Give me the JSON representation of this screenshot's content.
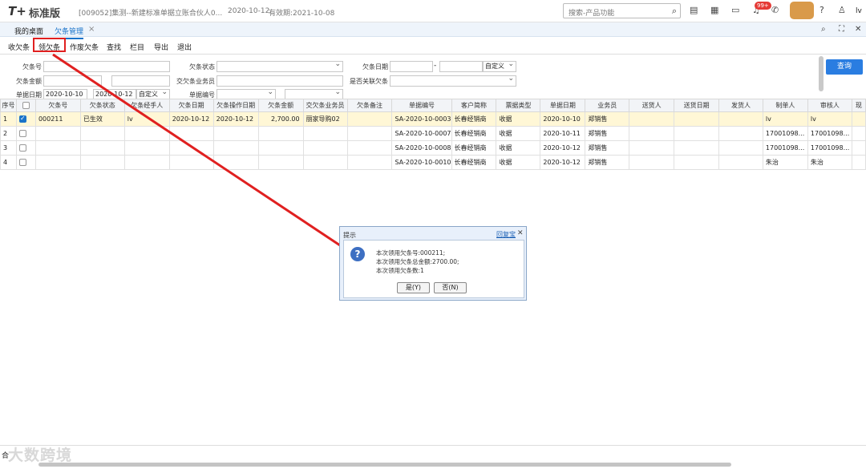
{
  "app": {
    "logo": "T+",
    "edition": "标准版",
    "company": "[009052]集测--新建标准单据立账合伙人0...",
    "date": "2020-10-12",
    "validity": "有效期:2021-10-08",
    "search_placeholder": "搜索-产品功能",
    "badge": "99+",
    "user": "lv"
  },
  "tabs": [
    {
      "label": "我的桌面"
    },
    {
      "label": "欠条管理"
    }
  ],
  "menu": [
    "收欠条",
    "领欠条",
    "作废欠条",
    "查找",
    "栏目",
    "导出",
    "退出"
  ],
  "filters": {
    "iou_no": "欠条号",
    "iou_status": "欠条状态",
    "iou_date": "欠条日期",
    "iou_amount": "欠条金额",
    "iou_agent": "交欠条业务员",
    "related": "是否关联欠条",
    "doc_date": "单据日期",
    "doc_date_from": "2020-10-10",
    "doc_date_to": "2020-10-12",
    "custom": "自定义",
    "doc_no": "单据编号",
    "query_button": "查询"
  },
  "table": {
    "columns": [
      "序号",
      "",
      "欠条号",
      "欠条状态",
      "欠条经手人",
      "欠条日期",
      "欠条操作日期",
      "欠条金额",
      "交欠条业务员",
      "欠条备注",
      "单据编号",
      "客户简称",
      "票据类型",
      "单据日期",
      "业务员",
      "送货人",
      "送货日期",
      "发货人",
      "制单人",
      "审核人",
      "现"
    ],
    "rows": [
      {
        "idx": "1",
        "checked": true,
        "iou_no": "000211",
        "status": "已生效",
        "handler": "lv",
        "date": "2020-10-12",
        "op_date": "2020-10-12",
        "amount": "2,700.00",
        "agent": "丽家导购02",
        "note": "",
        "doc_no": "SA-2020-10-0003",
        "customer": "长春经销商",
        "type": "收据",
        "doc_date": "2020-10-10",
        "salesman": "郑销售",
        "deliverer": "",
        "deliv_date": "",
        "shipper": "",
        "maker": "lv",
        "auditor": "lv"
      },
      {
        "idx": "2",
        "checked": false,
        "iou_no": "",
        "status": "",
        "handler": "",
        "date": "",
        "op_date": "",
        "amount": "",
        "agent": "",
        "note": "",
        "doc_no": "SA-2020-10-0007",
        "customer": "长春经销商",
        "type": "收据",
        "doc_date": "2020-10-11",
        "salesman": "郑销售",
        "deliverer": "",
        "deliv_date": "",
        "shipper": "",
        "maker": "17001098...",
        "auditor": "17001098..."
      },
      {
        "idx": "3",
        "checked": false,
        "iou_no": "",
        "status": "",
        "handler": "",
        "date": "",
        "op_date": "",
        "amount": "",
        "agent": "",
        "note": "",
        "doc_no": "SA-2020-10-0008",
        "customer": "长春经销商",
        "type": "收据",
        "doc_date": "2020-10-12",
        "salesman": "郑销售",
        "deliverer": "",
        "deliv_date": "",
        "shipper": "",
        "maker": "17001098...",
        "auditor": "17001098..."
      },
      {
        "idx": "4",
        "checked": false,
        "iou_no": "",
        "status": "",
        "handler": "",
        "date": "",
        "op_date": "",
        "amount": "",
        "agent": "",
        "note": "",
        "doc_no": "SA-2020-10-0010",
        "customer": "长春经销商",
        "type": "收据",
        "doc_date": "2020-10-12",
        "salesman": "郑销售",
        "deliverer": "",
        "deliv_date": "",
        "shipper": "",
        "maker": "朱治",
        "auditor": "朱治"
      }
    ]
  },
  "dialog": {
    "title": "提示",
    "link": "回复宝",
    "line1": "本次领用欠条号:000211;",
    "line2": "本次领用欠条总金额:2700.00;",
    "line3": "本次领用欠条数:1",
    "yes": "是(Y)",
    "no": "否(N)"
  },
  "footer": {
    "total": "合",
    "watermark": "大数跨境"
  },
  "colors": {
    "accent": "#1a73c9",
    "highlight": "#e02020"
  }
}
